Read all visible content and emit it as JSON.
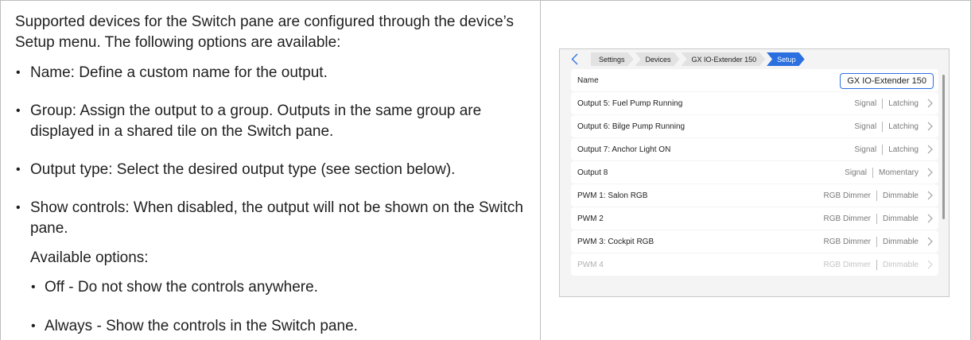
{
  "doc": {
    "intro": "Supported devices for the Switch pane are configured through the device’s Setup menu. The following options are available:",
    "bullets": [
      "Name: Define a custom name for the output.",
      "Group: Assign the output to a group. Outputs in the same group are displayed in a shared tile on the Switch pane.",
      "Output type: Select the desired output type (see section below).",
      "Show controls: When disabled, the output will not be shown on the Switch pane."
    ],
    "available_label": "Available options:",
    "options": [
      "Off - Do not show the controls anywhere.",
      "Always - Show the controls in the Switch pane."
    ],
    "bullet_glyph": "•"
  },
  "device": {
    "breadcrumbs": [
      "Settings",
      "Devices",
      "GX IO-Extender 150",
      "Setup"
    ],
    "name_row": {
      "label": "Name",
      "value": "GX IO-Extender 150"
    },
    "rows": [
      {
        "name": "Output 5: Fuel Pump Running",
        "type": "Signal",
        "mode": "Latching"
      },
      {
        "name": "Output 6: Bilge Pump Running",
        "type": "Signal",
        "mode": "Latching"
      },
      {
        "name": "Output 7: Anchor Light ON",
        "type": "Signal",
        "mode": "Latching"
      },
      {
        "name": "Output 8",
        "type": "Signal",
        "mode": "Momentary"
      },
      {
        "name": "PWM 1: Salon RGB",
        "type": "RGB Dimmer",
        "mode": "Dimmable"
      },
      {
        "name": "PWM 2",
        "type": "RGB Dimmer",
        "mode": "Dimmable"
      },
      {
        "name": "PWM 3: Cockpit RGB",
        "type": "RGB Dimmer",
        "mode": "Dimmable"
      },
      {
        "name": "PWM 4",
        "type": "RGB Dimmer",
        "mode": "Dimmable"
      }
    ],
    "colors": {
      "accent": "#2b6fe0",
      "background": "#f4f4f4",
      "row": "#ffffff"
    },
    "icons": {
      "back": "chevron-left-icon",
      "row": "chevron-right-icon"
    }
  }
}
